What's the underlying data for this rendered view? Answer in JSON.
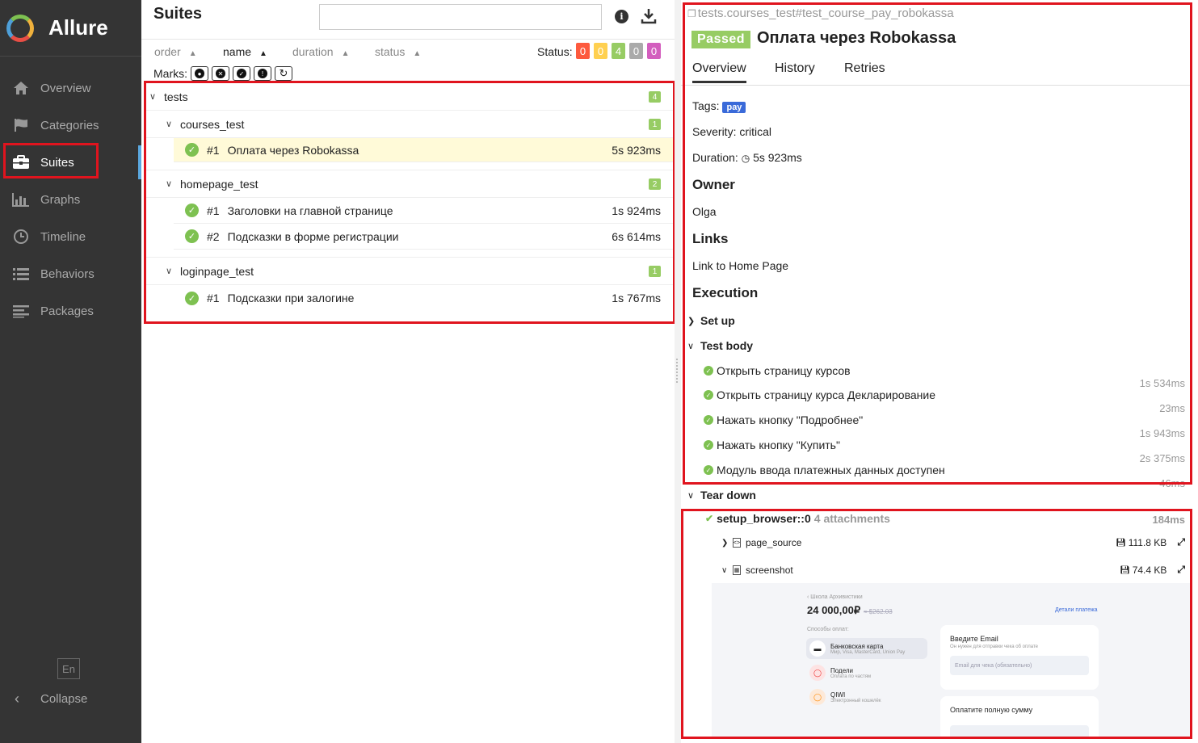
{
  "app": {
    "name": "Allure"
  },
  "sidebar": {
    "items": [
      {
        "label": "Overview",
        "icon": "home-icon"
      },
      {
        "label": "Categories",
        "icon": "flag-icon"
      },
      {
        "label": "Suites",
        "icon": "briefcase-icon"
      },
      {
        "label": "Graphs",
        "icon": "bar-chart-icon"
      },
      {
        "label": "Timeline",
        "icon": "clock-icon"
      },
      {
        "label": "Behaviors",
        "icon": "list-icon"
      },
      {
        "label": "Packages",
        "icon": "align-left-icon"
      }
    ],
    "active": "Suites",
    "language": "En",
    "collapse_label": "Collapse"
  },
  "suites": {
    "title": "Suites",
    "search_value": "",
    "sort": {
      "order": "order",
      "name": "name",
      "duration": "duration",
      "status": "status"
    },
    "status_label": "Status:",
    "status_counts": [
      {
        "value": "0",
        "color": "#fd5a3e"
      },
      {
        "value": "0",
        "color": "#ffd050"
      },
      {
        "value": "4",
        "color": "#97cc64"
      },
      {
        "value": "0",
        "color": "#aaaaaa"
      },
      {
        "value": "0",
        "color": "#d35ebe"
      }
    ],
    "marks_label": "Marks:",
    "tree": {
      "root": {
        "name": "tests",
        "count": "4"
      },
      "groups": [
        {
          "name": "courses_test",
          "count": "1",
          "cases": [
            {
              "num": "#1",
              "name": "Оплата через Robokassa",
              "duration": "5s 923ms",
              "selected": true
            }
          ]
        },
        {
          "name": "homepage_test",
          "count": "2",
          "cases": [
            {
              "num": "#1",
              "name": "Заголовки на главной странице",
              "duration": "1s 924ms"
            },
            {
              "num": "#2",
              "name": "Подсказки в форме регистрации",
              "duration": "6s 614ms"
            }
          ]
        },
        {
          "name": "loginpage_test",
          "count": "1",
          "cases": [
            {
              "num": "#1",
              "name": "Подсказки при залогине",
              "duration": "1s 767ms"
            }
          ]
        }
      ]
    }
  },
  "detail": {
    "uid": "tests.courses_test#test_course_pay_robokassa",
    "status": "Passed",
    "title": "Оплата через Robokassa",
    "tabs": [
      "Overview",
      "History",
      "Retries"
    ],
    "tags_label": "Tags:",
    "tag": "pay",
    "severity": "Severity: critical",
    "duration_label": "Duration:",
    "duration": "5s 923ms",
    "owner_heading": "Owner",
    "owner": "Olga",
    "links_heading": "Links",
    "link": "Link to Home Page",
    "execution_heading": "Execution",
    "setup_label": "Set up",
    "body_label": "Test body",
    "steps": [
      {
        "name": "Открыть страницу курсов",
        "duration": "1s 534ms"
      },
      {
        "name": "Открыть страницу курса Декларирование",
        "duration": "23ms"
      },
      {
        "name": "Нажать кнопку \"Подробнее\"",
        "duration": "1s 943ms"
      },
      {
        "name": "Нажать кнопку \"Купить\"",
        "duration": "2s 375ms"
      },
      {
        "name": "Модуль ввода платежных данных доступен",
        "duration": "46ms"
      }
    ],
    "teardown_label": "Tear down",
    "fixture": {
      "name": "setup_browser::0",
      "attachments": "4 attachments",
      "duration": "184ms"
    },
    "attachments": [
      {
        "name": "page_source",
        "size": "111.8 KB"
      },
      {
        "name": "screenshot",
        "size": "74.4 KB"
      }
    ]
  },
  "screenshot_preview": {
    "back": "Школа Архивистики",
    "price": "24 000,00₽",
    "price_old": "≈ $262.03",
    "details": "Детали платежа",
    "methods_label": "Способы оплат:",
    "methods": [
      {
        "name": "Банковская карта",
        "sub": "Мир, Visa, MasterCard, Union Pay"
      },
      {
        "name": "Подели",
        "sub": "Оплата по частям"
      },
      {
        "name": "QIWI",
        "sub": "Электронный кошелёк"
      }
    ],
    "email_heading": "Введите Email",
    "email_sub": "Он нужен для отправки чека об оплате",
    "email_placeholder": "Email для чека (обязательно)",
    "pay_heading": "Оплатите полную сумму"
  }
}
